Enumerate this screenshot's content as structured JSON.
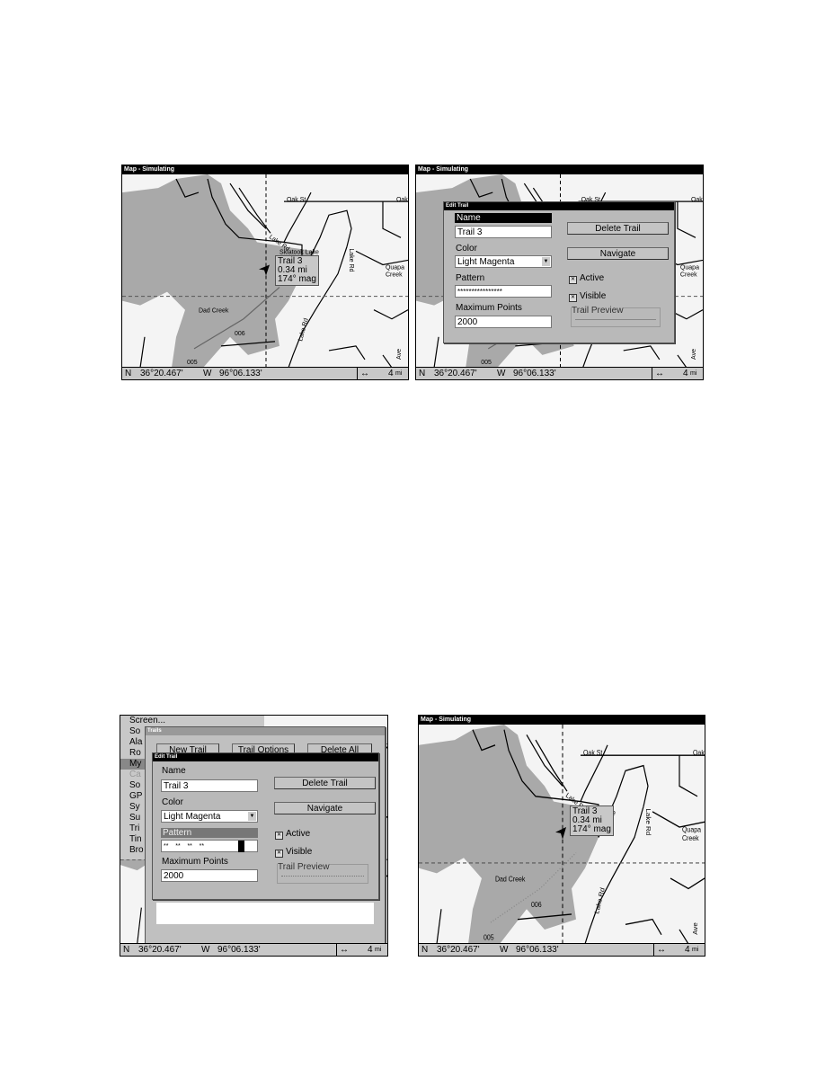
{
  "map_labels": {
    "oak_st": "Oak St",
    "oak_st2": "Oak",
    "skiatook": "Skiatook Lake",
    "lake_rd": "Lake Rd",
    "lake_rd2": "Lake Rd",
    "lake_rd3": "Lake Rd",
    "quapaw": "Quapa",
    "creek": "Creek",
    "dad_creek": "Dad Creek",
    "wp006": "006",
    "wp005": "005",
    "ave": "Ave"
  },
  "screen_title": "Map - Simulating",
  "status": {
    "lat_hemi": "N",
    "lat": "36°20.467'",
    "lon_hemi": "W",
    "lon": "96°06.133'",
    "scale_icon": "↔",
    "scale": "4",
    "scale_unit": "mi"
  },
  "trail_info": {
    "name": "Trail 3",
    "distance": "0.34 mi",
    "bearing": "174° mag"
  },
  "edit_trail": {
    "title": "Edit Trail",
    "name_label": "Name",
    "name_value": "Trail 3",
    "color_label": "Color",
    "color_value": "Light Magenta",
    "pattern_label": "Pattern",
    "pattern_value": "****************",
    "pattern_value_alt": "**    **    **    **",
    "max_points_label": "Maximum Points",
    "max_points_value": "2000",
    "delete_trail": "Delete Trail",
    "navigate": "Navigate",
    "active": "Active",
    "visible": "Visible",
    "check_mark": "✕",
    "trail_preview": "Trail Preview"
  },
  "trails_dialog": {
    "title": "Trails",
    "buttons": [
      "New Trail",
      "Trail Options",
      "Delete All"
    ]
  },
  "menu": {
    "items": [
      "Screen...",
      "So",
      "Ala",
      "Ro",
      "My",
      "Ca",
      "So",
      "GP",
      "Sy",
      "Su",
      "Tri",
      "Tin",
      "Bro"
    ],
    "selected_index": 4,
    "disabled_index": 5
  },
  "colors": {
    "lake": "#a9a9a9",
    "land": "#f4f4f4",
    "titlebar": "#000000",
    "dialog": "#b9b9b9"
  }
}
